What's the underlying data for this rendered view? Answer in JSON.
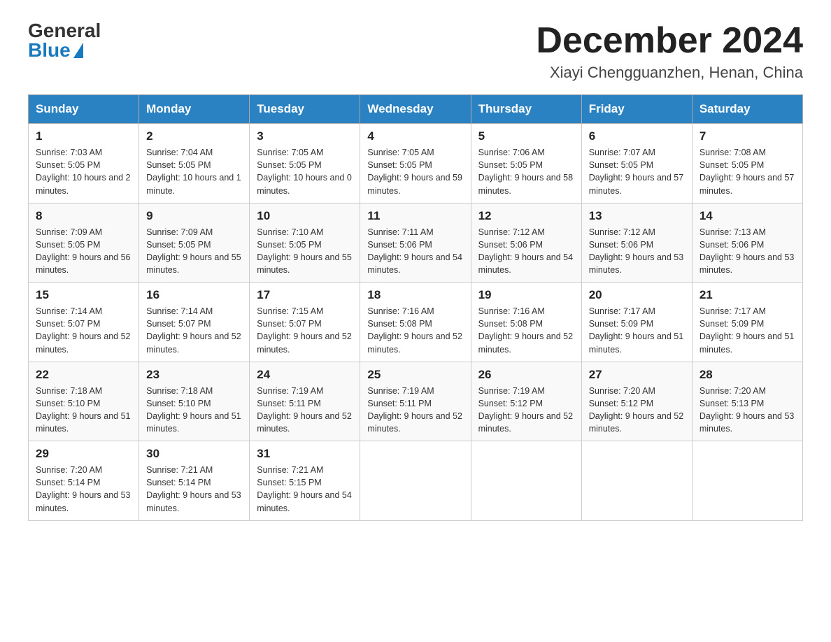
{
  "header": {
    "logo_general": "General",
    "logo_blue": "Blue",
    "month_title": "December 2024",
    "location": "Xiayi Chengguanzhen, Henan, China"
  },
  "days_of_week": [
    "Sunday",
    "Monday",
    "Tuesday",
    "Wednesday",
    "Thursday",
    "Friday",
    "Saturday"
  ],
  "weeks": [
    [
      {
        "day": "1",
        "sunrise": "7:03 AM",
        "sunset": "5:05 PM",
        "daylight": "10 hours and 2 minutes."
      },
      {
        "day": "2",
        "sunrise": "7:04 AM",
        "sunset": "5:05 PM",
        "daylight": "10 hours and 1 minute."
      },
      {
        "day": "3",
        "sunrise": "7:05 AM",
        "sunset": "5:05 PM",
        "daylight": "10 hours and 0 minutes."
      },
      {
        "day": "4",
        "sunrise": "7:05 AM",
        "sunset": "5:05 PM",
        "daylight": "9 hours and 59 minutes."
      },
      {
        "day": "5",
        "sunrise": "7:06 AM",
        "sunset": "5:05 PM",
        "daylight": "9 hours and 58 minutes."
      },
      {
        "day": "6",
        "sunrise": "7:07 AM",
        "sunset": "5:05 PM",
        "daylight": "9 hours and 57 minutes."
      },
      {
        "day": "7",
        "sunrise": "7:08 AM",
        "sunset": "5:05 PM",
        "daylight": "9 hours and 57 minutes."
      }
    ],
    [
      {
        "day": "8",
        "sunrise": "7:09 AM",
        "sunset": "5:05 PM",
        "daylight": "9 hours and 56 minutes."
      },
      {
        "day": "9",
        "sunrise": "7:09 AM",
        "sunset": "5:05 PM",
        "daylight": "9 hours and 55 minutes."
      },
      {
        "day": "10",
        "sunrise": "7:10 AM",
        "sunset": "5:05 PM",
        "daylight": "9 hours and 55 minutes."
      },
      {
        "day": "11",
        "sunrise": "7:11 AM",
        "sunset": "5:06 PM",
        "daylight": "9 hours and 54 minutes."
      },
      {
        "day": "12",
        "sunrise": "7:12 AM",
        "sunset": "5:06 PM",
        "daylight": "9 hours and 54 minutes."
      },
      {
        "day": "13",
        "sunrise": "7:12 AM",
        "sunset": "5:06 PM",
        "daylight": "9 hours and 53 minutes."
      },
      {
        "day": "14",
        "sunrise": "7:13 AM",
        "sunset": "5:06 PM",
        "daylight": "9 hours and 53 minutes."
      }
    ],
    [
      {
        "day": "15",
        "sunrise": "7:14 AM",
        "sunset": "5:07 PM",
        "daylight": "9 hours and 52 minutes."
      },
      {
        "day": "16",
        "sunrise": "7:14 AM",
        "sunset": "5:07 PM",
        "daylight": "9 hours and 52 minutes."
      },
      {
        "day": "17",
        "sunrise": "7:15 AM",
        "sunset": "5:07 PM",
        "daylight": "9 hours and 52 minutes."
      },
      {
        "day": "18",
        "sunrise": "7:16 AM",
        "sunset": "5:08 PM",
        "daylight": "9 hours and 52 minutes."
      },
      {
        "day": "19",
        "sunrise": "7:16 AM",
        "sunset": "5:08 PM",
        "daylight": "9 hours and 52 minutes."
      },
      {
        "day": "20",
        "sunrise": "7:17 AM",
        "sunset": "5:09 PM",
        "daylight": "9 hours and 51 minutes."
      },
      {
        "day": "21",
        "sunrise": "7:17 AM",
        "sunset": "5:09 PM",
        "daylight": "9 hours and 51 minutes."
      }
    ],
    [
      {
        "day": "22",
        "sunrise": "7:18 AM",
        "sunset": "5:10 PM",
        "daylight": "9 hours and 51 minutes."
      },
      {
        "day": "23",
        "sunrise": "7:18 AM",
        "sunset": "5:10 PM",
        "daylight": "9 hours and 51 minutes."
      },
      {
        "day": "24",
        "sunrise": "7:19 AM",
        "sunset": "5:11 PM",
        "daylight": "9 hours and 52 minutes."
      },
      {
        "day": "25",
        "sunrise": "7:19 AM",
        "sunset": "5:11 PM",
        "daylight": "9 hours and 52 minutes."
      },
      {
        "day": "26",
        "sunrise": "7:19 AM",
        "sunset": "5:12 PM",
        "daylight": "9 hours and 52 minutes."
      },
      {
        "day": "27",
        "sunrise": "7:20 AM",
        "sunset": "5:12 PM",
        "daylight": "9 hours and 52 minutes."
      },
      {
        "day": "28",
        "sunrise": "7:20 AM",
        "sunset": "5:13 PM",
        "daylight": "9 hours and 53 minutes."
      }
    ],
    [
      {
        "day": "29",
        "sunrise": "7:20 AM",
        "sunset": "5:14 PM",
        "daylight": "9 hours and 53 minutes."
      },
      {
        "day": "30",
        "sunrise": "7:21 AM",
        "sunset": "5:14 PM",
        "daylight": "9 hours and 53 minutes."
      },
      {
        "day": "31",
        "sunrise": "7:21 AM",
        "sunset": "5:15 PM",
        "daylight": "9 hours and 54 minutes."
      },
      null,
      null,
      null,
      null
    ]
  ]
}
